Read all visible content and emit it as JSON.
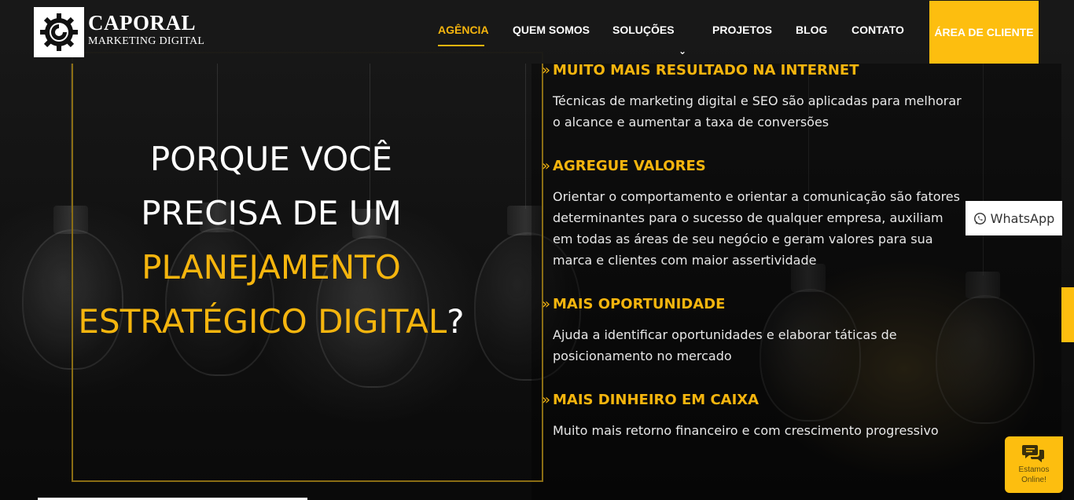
{
  "brand": {
    "name": "CAPORAL",
    "tagline": "MARKETING DIGITAL"
  },
  "nav": {
    "items": [
      {
        "label": "AGÊNCIA",
        "active": true
      },
      {
        "label": "QUEM SOMOS"
      },
      {
        "label": "SOLUÇÕES"
      },
      {
        "label": "PROJETOS"
      },
      {
        "label": "BLOG"
      },
      {
        "label": "CONTATO"
      }
    ],
    "client_area": "ÁREA DE CLIENTE"
  },
  "hero": {
    "line1": "PORQUE VOCÊ",
    "line2": "PRECISA DE UM",
    "line3": "PLANEJAMENTO",
    "line4_gold": "ESTRATÉGICO DIGITAL",
    "line4_end": "?"
  },
  "features": [
    {
      "title": "MUITO MAIS RESULTADO NA INTERNET",
      "desc": "Técnicas de marketing digital e SEO são aplicadas para melhorar o alcance e aumentar a taxa de conversões"
    },
    {
      "title": "AGREGUE VALORES",
      "desc": "Orientar o comportamento e orientar a comunicação são fatores determinantes para o sucesso de qualquer empresa, auxiliam em todas as áreas de seu negócio e geram valores para sua marca e clientes com maior assertividade"
    },
    {
      "title": "MAIS OPORTUNIDADE",
      "desc": "Ajuda a identificar oportunidades e elaborar táticas de posicionamento no mercado"
    },
    {
      "title": "MAIS DINHEIRO EM CAIXA",
      "desc": "Muito mais retorno financeiro e com crescimento progressivo"
    }
  ],
  "bullet": "»",
  "whatsapp": {
    "label": "WhatsApp",
    "icon": "whatsapp-icon"
  },
  "chat": {
    "line1": "Estamos",
    "line2": "Online!",
    "icon": "chat-bubbles-icon"
  },
  "colors": {
    "accent": "#f5b50e",
    "button": "#fdbe0f",
    "background": "#111111"
  }
}
